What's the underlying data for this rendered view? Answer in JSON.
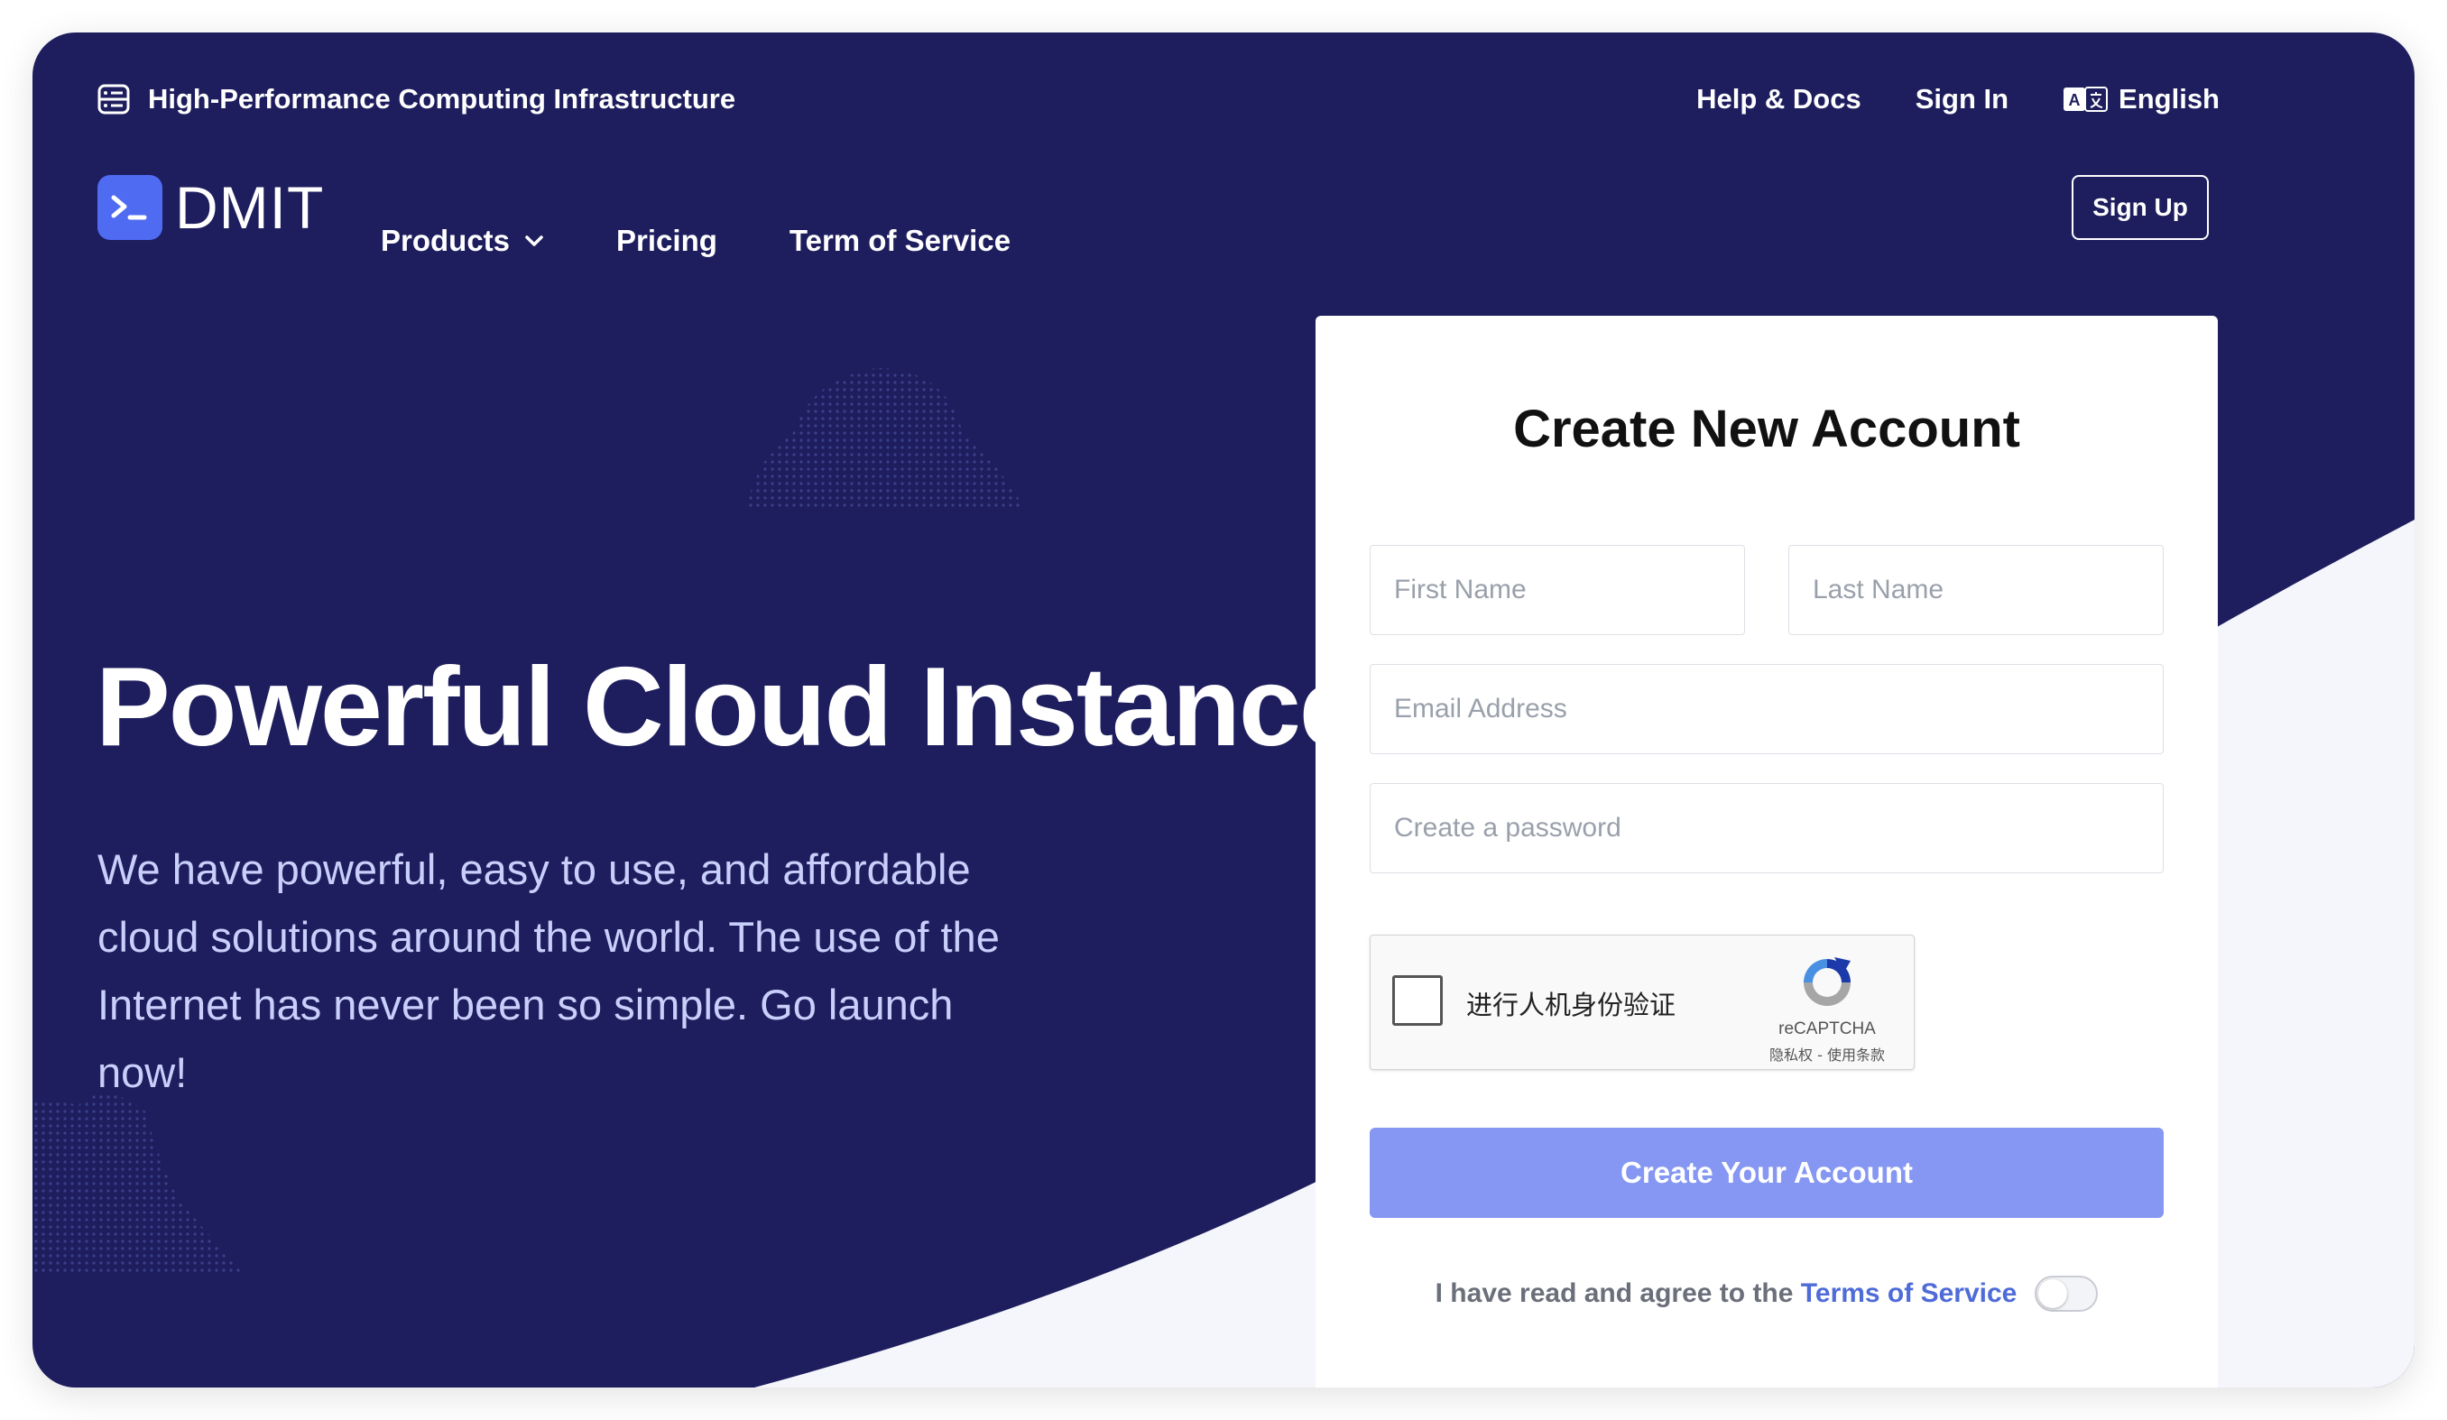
{
  "topbar": {
    "tagline": "High-Performance Computing Infrastructure",
    "links": {
      "help": "Help & Docs",
      "signin": "Sign In",
      "language": "English"
    }
  },
  "nav": {
    "brand": "DMIT",
    "items": {
      "products": "Products",
      "pricing": "Pricing",
      "terms": "Term of Service"
    },
    "signup": "Sign Up"
  },
  "hero": {
    "title": "Powerful Cloud Instance",
    "text": "We have powerful, easy to use, and affordable cloud solutions around the world. The use of the Internet has never been so simple. Go launch now!"
  },
  "form": {
    "title": "Create New Account",
    "first_name": {
      "placeholder": "First Name",
      "value": ""
    },
    "last_name": {
      "placeholder": "Last Name",
      "value": ""
    },
    "email": {
      "placeholder": "Email Address",
      "value": ""
    },
    "password": {
      "placeholder": "Create a password",
      "value": ""
    },
    "captcha": {
      "label": "进行人机身份验证",
      "brand": "reCAPTCHA",
      "links": "隐私权 - 使用条款"
    },
    "submit": "Create Your Account",
    "agree_text": "I have read and agree to the",
    "agree_link": "Terms of Service"
  },
  "colors": {
    "hero_bg": "#1e1e5e",
    "accent": "#4f6bf2",
    "button": "#8597f2",
    "link": "#4f6bd8"
  }
}
